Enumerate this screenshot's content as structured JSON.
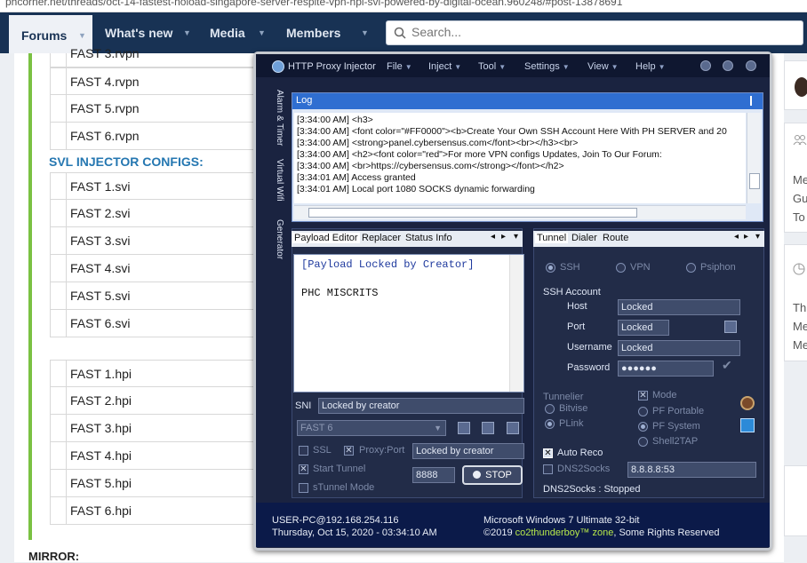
{
  "browser": {
    "url": "phcorner.net/threads/oct-14-fastest-noload-singapore-server-respite-vpn-hpi-svi-powered-by-digital-ocean.960248/#post-13878691"
  },
  "nav": {
    "items": [
      {
        "label": "Forums"
      },
      {
        "label": "What's new"
      },
      {
        "label": "Media"
      },
      {
        "label": "Members"
      }
    ],
    "search_placeholder": "Search..."
  },
  "page": {
    "rows_top": [
      "FAST 3.rvpn",
      "FAST 4.rvpn",
      "FAST 5.rvpn",
      "FAST 6.rvpn"
    ],
    "svl_heading": "SVL INJECTOR CONFIGS:",
    "rows_svi": [
      "FAST 1.svi",
      "FAST 2.svi",
      "FAST 3.svi",
      "FAST 4.svi",
      "FAST 5.svi",
      "FAST 6.svi"
    ],
    "rows_hpi": [
      "FAST 1.hpi",
      "FAST 2.hpi",
      "FAST 3.hpi",
      "FAST 4.hpi",
      "FAST 5.hpi",
      "FAST 6.hpi"
    ],
    "mirror": "MIRROR:",
    "right_snippets": [
      "Me",
      "Gu",
      "To",
      "Th",
      "Me",
      "Me"
    ]
  },
  "app": {
    "title": "HTTP Proxy Injector",
    "menus": [
      "File",
      "Inject",
      "Tool",
      "Settings",
      "View",
      "Help"
    ],
    "side_tabs": [
      "Alarm & Timer",
      "Virtual Wifi",
      "Generator"
    ],
    "log": {
      "title": "Log",
      "lines": [
        "[3:34:00 AM]  <h3>",
        "[3:34:00 AM]  <font color=\"#FF0000\"><b>Create Your Own SSH Account Here With PH SERVER and 20",
        "[3:34:00 AM]  <strong>panel.cybersensus.com</font><br></h3><br>",
        "[3:34:00 AM]  <h2><font color=\"red\">For more VPN configs Updates, Join To Our Forum:",
        "[3:34:00 AM]  <br>https://cybersensus.com</strong></font></h2>",
        "[3:34:01 AM]  Access granted",
        "[3:34:01 AM]  Local port 1080 SOCKS dynamic forwarding"
      ]
    },
    "left_tabs": [
      "Payload Editor",
      "Replacer",
      "Status Info"
    ],
    "payload_lines": [
      "[Payload Locked by Creator]",
      "PHC MISCRITS"
    ],
    "sni_label": "SNI",
    "sni_value": "Locked by creator",
    "profile": "FAST 6",
    "ssl_label": "SSL",
    "proxy_port_label": "Proxy:Port",
    "proxy_port_value": "Locked by creator",
    "start_tunnel_label": "Start Tunnel",
    "stunnel_label": "sTunnel Mode",
    "port_value": "8888",
    "stop_label": "STOP",
    "right_tabs": [
      "Tunnel",
      "Dialer",
      "Route"
    ],
    "protocols": [
      "SSH",
      "VPN",
      "Psiphon"
    ],
    "ssh_account_label": "SSH Account",
    "host_label": "Host",
    "host_value": "Locked",
    "port_label": "Port",
    "port_field_value": "Locked",
    "username_label": "Username",
    "username_value": "Locked",
    "password_label": "Password",
    "password_value": "●●●●●●",
    "tunnelier_label": "Tunnelier",
    "tunnelier_options": [
      "Bitvise",
      "PLink"
    ],
    "mode_label": "Mode",
    "mode_options": [
      "PF Portable",
      "PF System",
      "Shell2TAP"
    ],
    "auto_reco_label": "Auto Reco",
    "dns2socks_label": "DNS2Socks",
    "dns_value": "8.8.8.8:53",
    "dns_status": "DNS2Socks : Stopped",
    "footer": {
      "host": "USER-PC@192.168.254.116",
      "datetime": "Thursday, Oct 15, 2020 - 03:34:10 AM",
      "os": "Microsoft Windows 7 Ultimate  32-bit",
      "copyright_prefix": "©2019 ",
      "copyright_link": "co2thunderboy™ zone",
      "copyright_suffix": ", Some Rights Reserved"
    }
  }
}
